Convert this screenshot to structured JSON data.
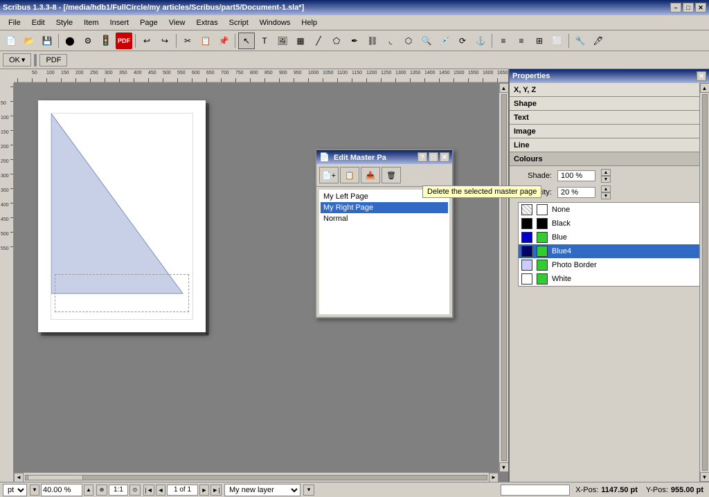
{
  "window": {
    "title": "Scribus 1.3.3-8 - [/media/hdb1/FullCircle/my articles/Scribus/part5/Document-1.sla*]",
    "close": "✕",
    "minimize": "–",
    "maximize": "□"
  },
  "menu": {
    "items": [
      "File",
      "Edit",
      "Style",
      "Item",
      "Insert",
      "Page",
      "View",
      "Extras",
      "Script",
      "Windows",
      "Help"
    ]
  },
  "ok_toolbar": {
    "ok_label": "OK",
    "pdf_label": "PDF"
  },
  "edit_master_dialog": {
    "title": "Edit Master Pa",
    "list_items": [
      {
        "label": "My Left Page",
        "selected": false
      },
      {
        "label": "My Right Page",
        "selected": true
      },
      {
        "label": "Normal",
        "selected": false
      }
    ]
  },
  "tooltip": {
    "text": "Delete the selected master page"
  },
  "properties": {
    "title": "Properties",
    "sections": [
      {
        "label": "X, Y, Z"
      },
      {
        "label": "Shape"
      },
      {
        "label": "Text"
      },
      {
        "label": "Image"
      },
      {
        "label": "Line"
      },
      {
        "label": "Colours"
      }
    ],
    "shade": {
      "label": "Shade:",
      "value": "100 %"
    },
    "opacity": {
      "label": "Opacity:",
      "value": "20 %"
    },
    "colors": [
      {
        "name": "None",
        "left": "transparent",
        "right": "transparent",
        "selected": false
      },
      {
        "name": "Black",
        "left": "#000000",
        "right": "#000000",
        "selected": false
      },
      {
        "name": "Blue",
        "left": "#0000cc",
        "right": "#33cc33",
        "selected": false
      },
      {
        "name": "Blue4",
        "left": "#000066",
        "right": "#33cc33",
        "selected": true
      },
      {
        "name": "Photo Border",
        "left": "#ccccff",
        "right": "#33cc33",
        "selected": false
      },
      {
        "name": "White",
        "left": "#ffffff",
        "right": "#33cc33",
        "selected": false
      }
    ]
  },
  "statusbar": {
    "unit": "pt",
    "zoom": "40.00 %",
    "ratio": "1:1",
    "page_nav": "1 of 1",
    "layer": "My new layer",
    "xpos_label": "X-Pos:",
    "xpos_value": "1147.50 pt",
    "ypos_label": "Y-Pos:",
    "ypos_value": "955.00 pt"
  }
}
